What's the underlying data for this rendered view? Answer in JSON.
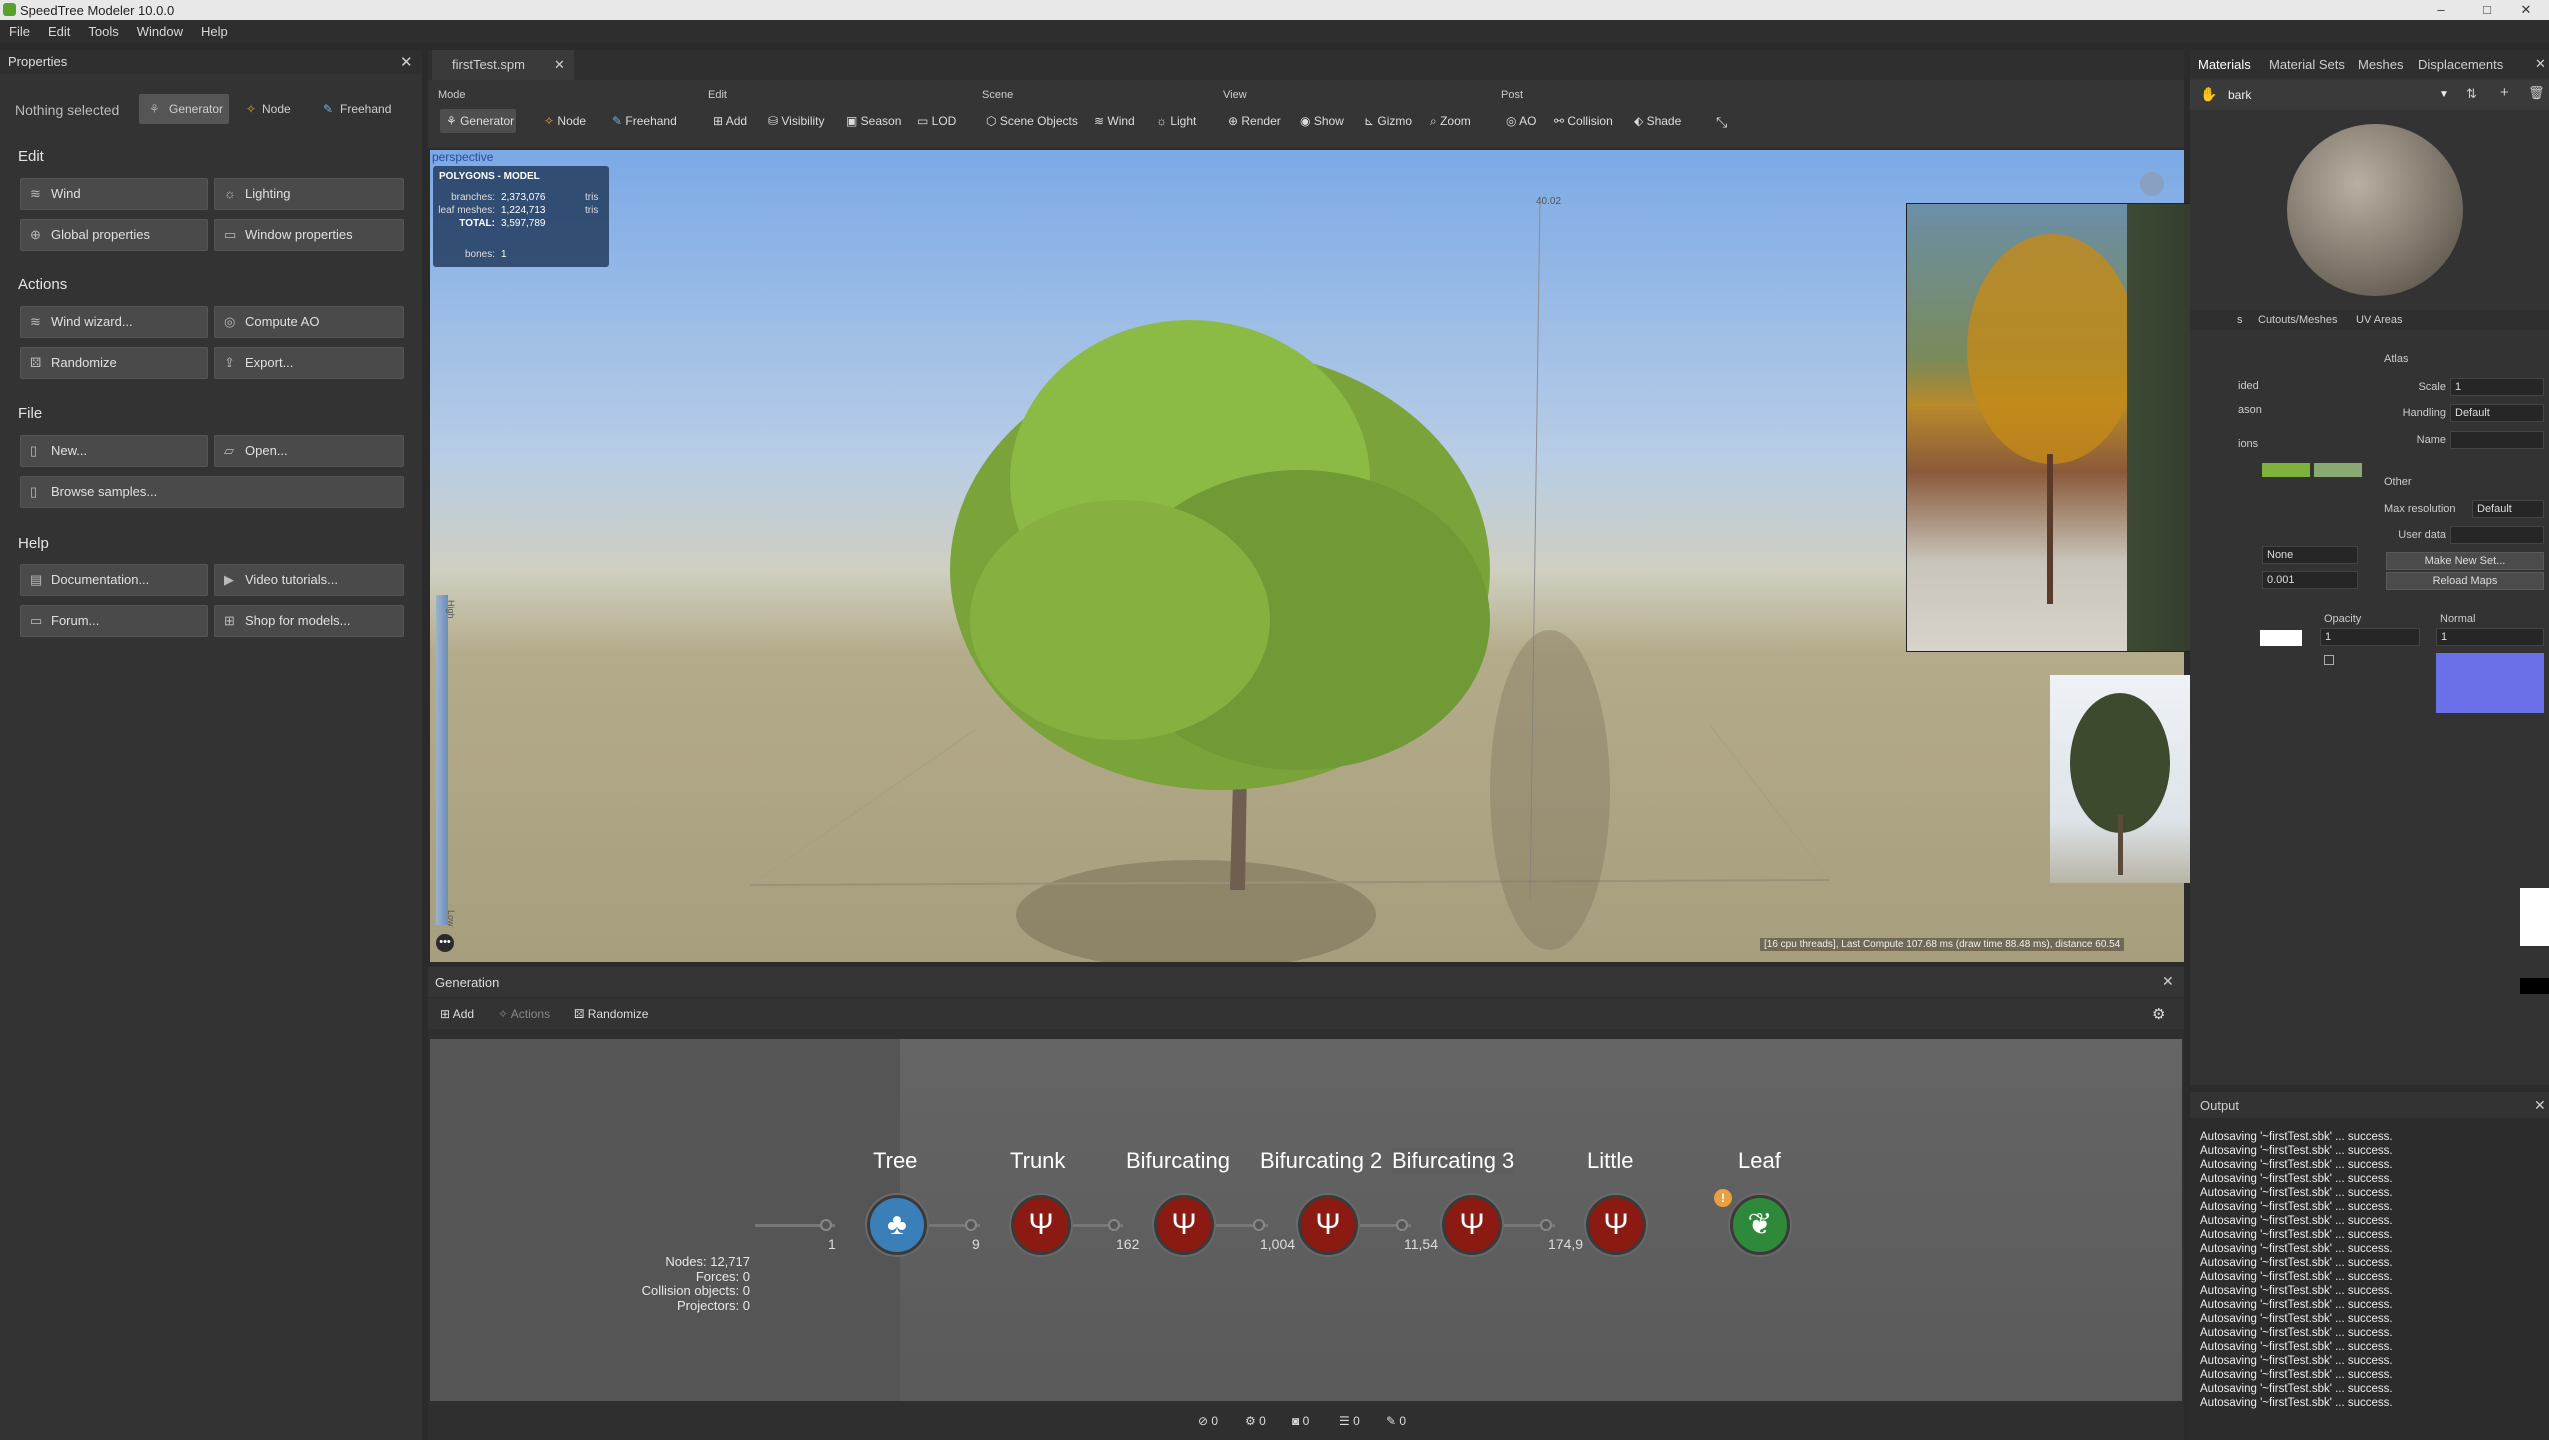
{
  "window": {
    "title": "SpeedTree  Modeler 10.0.0",
    "minimize": "–",
    "maximize": "□",
    "close": "✕"
  },
  "menu": [
    "File",
    "Edit",
    "Tools",
    "Window",
    "Help"
  ],
  "properties": {
    "title": "Properties",
    "close": "✕",
    "selection": "Nothing selected",
    "mode_buttons": [
      "Generator",
      "Node",
      "Freehand"
    ],
    "sections": {
      "edit": "Edit",
      "actions": "Actions",
      "file": "File",
      "help": "Help"
    },
    "edit_buttons": [
      "Wind",
      "Lighting",
      "Global properties",
      "Window properties"
    ],
    "action_buttons": [
      "Wind wizard...",
      "Compute AO",
      "Randomize",
      "Export..."
    ],
    "file_buttons": [
      "New...",
      "Open...",
      "Browse samples..."
    ],
    "help_buttons": [
      "Documentation...",
      "Video tutorials...",
      "Forum...",
      "Shop for models..."
    ]
  },
  "document": {
    "tab": "firstTest.spm",
    "close": "✕"
  },
  "toolbar": {
    "groups": [
      "Mode",
      "Edit",
      "Scene",
      "View",
      "Post"
    ],
    "mode": [
      "Generator",
      "Node",
      "Freehand"
    ],
    "edit": [
      "Add",
      "Visibility",
      "Season",
      "LOD"
    ],
    "scene": [
      "Scene Objects",
      "Wind",
      "Light"
    ],
    "view": [
      "Render",
      "Show",
      "Gizmo",
      "Zoom"
    ],
    "post": [
      "AO",
      "Collision",
      "Shade"
    ]
  },
  "viewport": {
    "label": "perspective",
    "stats_title": "POLYGONS - MODEL",
    "stats": [
      {
        "k": "branches:",
        "v": "2,373,076",
        "u": "tris"
      },
      {
        "k": "leaf meshes:",
        "v": "1,224,713",
        "u": "tris"
      },
      {
        "k": "TOTAL:",
        "v": "3,597,789",
        "u": ""
      }
    ],
    "bones_label": "bones:",
    "bones": "1",
    "ruler": "40.02",
    "slider_high": "High",
    "slider_low": "Low",
    "status": "[16 cpu threads], Last Compute 107.68 ms (draw time 88.48 ms), distance 60.54"
  },
  "generation": {
    "title": "Generation",
    "close": "✕",
    "toolbar": [
      "Add",
      "Actions",
      "Randomize"
    ],
    "nodes": [
      {
        "label": "Tree",
        "color": "#3b7fb8",
        "icon": "tree-icon"
      },
      {
        "label": "Trunk",
        "color": "#8a1a12",
        "icon": "branch-icon"
      },
      {
        "label": "Bifurcating",
        "color": "#8a1a12",
        "icon": "branch-icon"
      },
      {
        "label": "Bifurcating 2",
        "color": "#8a1a12",
        "icon": "branch-icon"
      },
      {
        "label": "Bifurcating 3",
        "color": "#8a1a12",
        "icon": "branch-icon"
      },
      {
        "label": "Little",
        "color": "#8a1a12",
        "icon": "branch-icon"
      },
      {
        "label": "Leaf",
        "color": "#2e8a3a",
        "icon": "leaf-icon"
      }
    ],
    "counts": [
      "1",
      "9",
      "162",
      "1,004",
      "11,54",
      "174,9"
    ],
    "stats": [
      "Nodes: 12,717",
      "Forces: 0",
      "Collision objects: 0",
      "Projectors: 0"
    ],
    "bottom_counts": [
      "0",
      "0",
      "0",
      "0",
      "0"
    ]
  },
  "materials": {
    "tabs": [
      "Materials",
      "Material Sets",
      "Meshes",
      "Displacements"
    ],
    "close": "✕",
    "current": "bark",
    "subtabs": [
      "s",
      "Cutouts/Meshes",
      "UV Areas"
    ],
    "atlas": {
      "title": "Atlas",
      "scale_label": "Scale",
      "scale": "1",
      "handling_label": "Handling",
      "handling": "Default",
      "name_label": "Name"
    },
    "other": {
      "title": "Other",
      "maxres_label": "Max resolution",
      "maxres": "Default",
      "userdata_label": "User data",
      "make_set": "Make New Set...",
      "reload": "Reload Maps"
    },
    "partial_labels": [
      "ided",
      "ason",
      "ions"
    ],
    "none": "None",
    "small": "0.001",
    "opacity_label": "Opacity",
    "opacity": "1",
    "normal_label": "Normal",
    "normal": "1",
    "swatch_colors": [
      "#7fb23c",
      "#8aa871"
    ]
  },
  "output": {
    "title": "Output",
    "close": "✕",
    "lines": [
      "Autosaving '~firstTest.sbk' ... success.",
      "Autosaving '~firstTest.sbk' ... success.",
      "Autosaving '~firstTest.sbk' ... success.",
      "Autosaving '~firstTest.sbk' ... success.",
      "Autosaving '~firstTest.sbk' ... success.",
      "Autosaving '~firstTest.sbk' ... success.",
      "Autosaving '~firstTest.sbk' ... success.",
      "Autosaving '~firstTest.sbk' ... success.",
      "Autosaving '~firstTest.sbk' ... success.",
      "Autosaving '~firstTest.sbk' ... success.",
      "Autosaving '~firstTest.sbk' ... success.",
      "Autosaving '~firstTest.sbk' ... success.",
      "Autosaving '~firstTest.sbk' ... success.",
      "Autosaving '~firstTest.sbk' ... success.",
      "Autosaving '~firstTest.sbk' ... success.",
      "Autosaving '~firstTest.sbk' ... success.",
      "Autosaving '~firstTest.sbk' ... success.",
      "Autosaving '~firstTest.sbk' ... success.",
      "Autosaving '~firstTest.sbk' ... success.",
      "Autosaving '~firstTest.sbk' ... success."
    ]
  }
}
